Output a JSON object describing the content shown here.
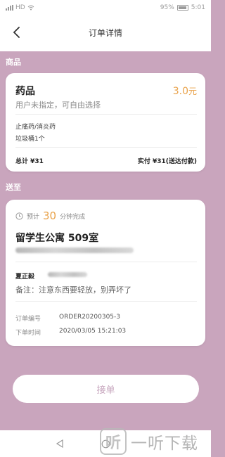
{
  "status_bar": {
    "left_text": "HD",
    "battery": "95%",
    "time": "5:01"
  },
  "nav": {
    "title": "订单详情",
    "back_icon": "chevron-left-icon"
  },
  "goods_section": {
    "label": "商品",
    "name": "药品",
    "price_value": "3.0",
    "price_unit": "元",
    "subtitle": "用户未指定，可自由选择",
    "items": [
      "止痛药/消炎药",
      "垃圾桶1个"
    ],
    "total": "总计 ¥31",
    "paid": "实付 ¥31(送达付款)"
  },
  "deliver_section": {
    "label": "送至",
    "eta_prefix": "预计",
    "eta_minutes": "30",
    "eta_suffix": "分钟完成",
    "address_name": "留学生公寓 509室",
    "contact_name": "夏正毅",
    "note": "备注：注意东西要轻放，别弄坏了",
    "order_no_label": "订单编号",
    "order_no": "ORDER20200305-3",
    "order_time_label": "下单时间",
    "order_time": "2020/03/05 15:21:03"
  },
  "accept_button": "接单",
  "watermark": {
    "logo": "听",
    "text": "一听下载"
  },
  "colors": {
    "background": "#c9a5bd",
    "accent": "#e9a24a",
    "card": "#ffffff"
  }
}
